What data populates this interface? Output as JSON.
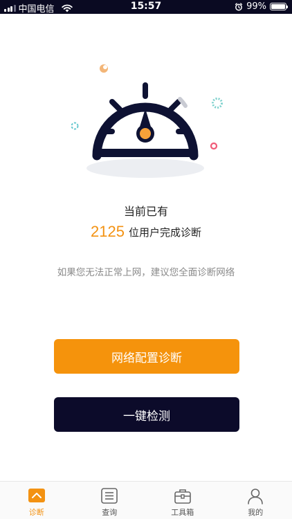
{
  "status_bar": {
    "carrier": "中国电信",
    "time": "15:57",
    "battery": "99%",
    "battery_level": 0.99
  },
  "diagnose": {
    "title": "当前已有",
    "user_count": "2125",
    "count_suffix": "位用户完成诊断",
    "hint": "如果您无法正常上网，建议您全面诊断网络"
  },
  "buttons": {
    "network_config": "网络配置诊断",
    "one_click_check": "一键检测"
  },
  "tabbar": {
    "tabs": [
      {
        "label": "诊断",
        "icon": "gauge-icon",
        "active": true
      },
      {
        "label": "查询",
        "icon": "list-icon",
        "active": false
      },
      {
        "label": "工具箱",
        "icon": "toolbox-icon",
        "active": false
      },
      {
        "label": "我的",
        "icon": "user-icon",
        "active": false
      }
    ]
  },
  "colors": {
    "accent": "#f5930c",
    "dark": "#0c0b2a",
    "status_bar": "#0a0a22"
  }
}
